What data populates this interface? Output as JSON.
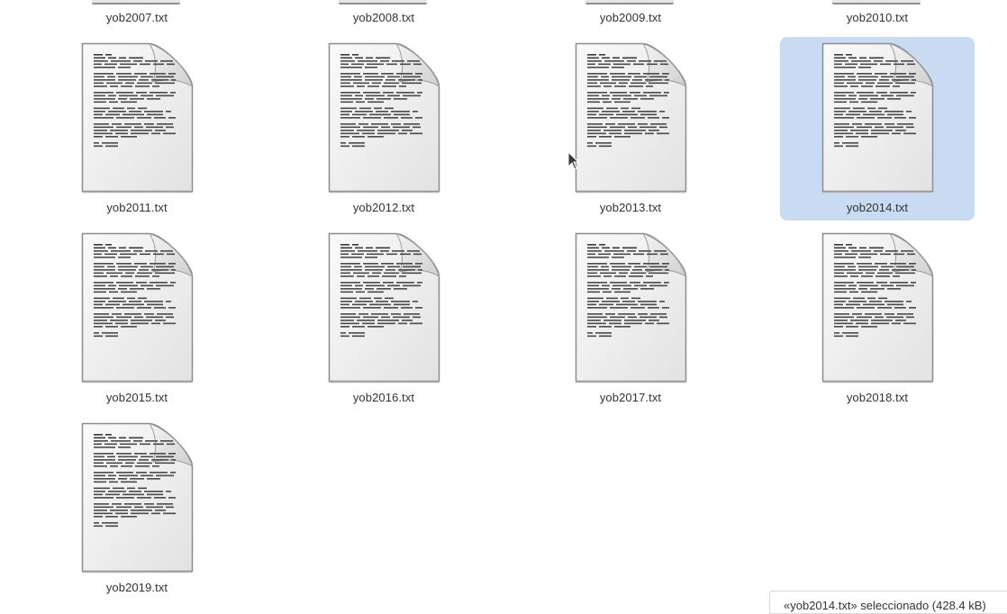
{
  "files": [
    {
      "name": "yob2007.txt",
      "partial": true,
      "selected": false
    },
    {
      "name": "yob2008.txt",
      "partial": true,
      "selected": false
    },
    {
      "name": "yob2009.txt",
      "partial": true,
      "selected": false
    },
    {
      "name": "yob2010.txt",
      "partial": true,
      "selected": false
    },
    {
      "name": "yob2011.txt",
      "partial": false,
      "selected": false
    },
    {
      "name": "yob2012.txt",
      "partial": false,
      "selected": false
    },
    {
      "name": "yob2013.txt",
      "partial": false,
      "selected": false
    },
    {
      "name": "yob2014.txt",
      "partial": false,
      "selected": true
    },
    {
      "name": "yob2015.txt",
      "partial": false,
      "selected": false
    },
    {
      "name": "yob2016.txt",
      "partial": false,
      "selected": false
    },
    {
      "name": "yob2017.txt",
      "partial": false,
      "selected": false
    },
    {
      "name": "yob2018.txt",
      "partial": false,
      "selected": false
    },
    {
      "name": "yob2019.txt",
      "partial": false,
      "selected": false
    }
  ],
  "status_bar": {
    "text": "«yob2014.txt» seleccionado  (428.4 kB)"
  },
  "icon": "text-document-icon",
  "colors": {
    "selection": "#c9daf3",
    "text": "#2e3436"
  }
}
